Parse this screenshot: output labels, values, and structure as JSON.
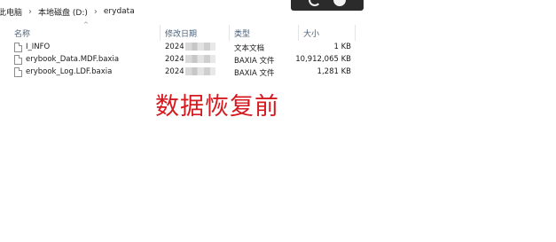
{
  "breadcrumb": [
    "此电脑",
    "本地磁盘 (D:)",
    "erydata"
  ],
  "columns": {
    "name": "名称",
    "modified": "修改日期",
    "type": "类型",
    "size": "大小"
  },
  "files": [
    {
      "name": "I_INFO",
      "modified": "2024",
      "type": "文本文档",
      "size": "1 KB",
      "icon": "text-file-icon"
    },
    {
      "name": "erybook_Data.MDF.baxia",
      "modified": "2024",
      "type": "BAXIA 文件",
      "size": "10,912,065 KB",
      "icon": "generic-file-icon"
    },
    {
      "name": "erybook_Log.LDF.baxia",
      "modified": "2024",
      "type": "BAXIA 文件",
      "size": "1,281 KB",
      "icon": "generic-file-icon"
    }
  ],
  "annotation": "数据恢复前",
  "colors": {
    "annotation": "#d6191e",
    "header_text": "#4c607a"
  }
}
